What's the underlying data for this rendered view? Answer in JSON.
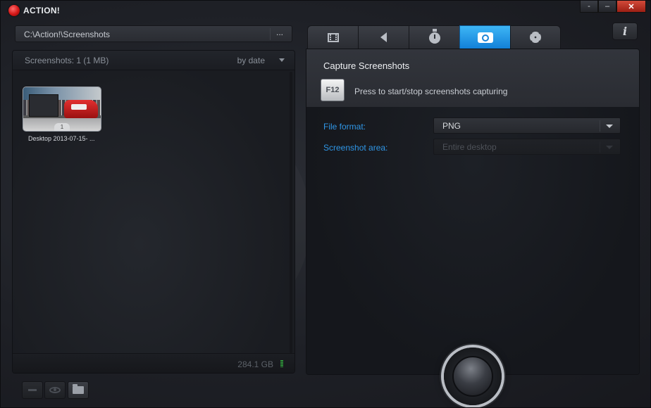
{
  "app": {
    "title": "ACTION!"
  },
  "window_controls": {
    "minimize2": "-",
    "minimize": "–",
    "close": "✕"
  },
  "path_bar": {
    "path": "C:\\Action!\\Screenshots",
    "more_label": "..."
  },
  "gallery": {
    "count_label": "Screenshots: 1 (1 MB)",
    "sort_label": "by date",
    "items": [
      {
        "label": "Desktop 2013-07-15- ...",
        "badge": "1"
      }
    ],
    "disk_free": "284.1 GB"
  },
  "tabs": [
    {
      "id": "video",
      "icon": "film-icon",
      "active": false
    },
    {
      "id": "audio",
      "icon": "speaker-icon",
      "active": false
    },
    {
      "id": "timer",
      "icon": "stopwatch-icon",
      "active": false
    },
    {
      "id": "screenshots",
      "icon": "camera-icon",
      "active": true
    },
    {
      "id": "settings",
      "icon": "gear-icon",
      "active": false
    }
  ],
  "info_button": {
    "label": "i"
  },
  "screenshot_settings": {
    "title": "Capture Screenshots",
    "hotkey": "F12",
    "hotkey_desc": "Press to start/stop screenshots capturing",
    "file_format": {
      "label": "File format:",
      "value": "PNG"
    },
    "screenshot_area": {
      "label": "Screenshot area:",
      "value": "Entire desktop",
      "disabled": true
    }
  },
  "colors": {
    "accent": "#1a84d8",
    "label_blue": "#2f96e6",
    "brand_red": "#d21616"
  }
}
